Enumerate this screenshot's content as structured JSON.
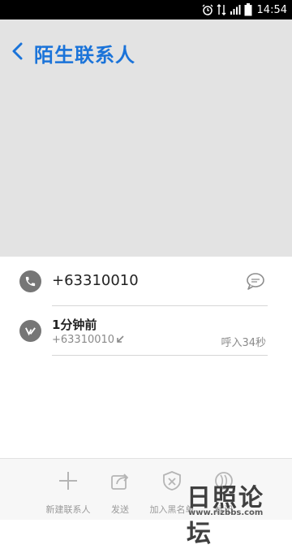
{
  "status": {
    "time": "14:54"
  },
  "header": {
    "title": "陌生联系人"
  },
  "contact": {
    "phone": "+63310010"
  },
  "call_log": {
    "time_ago": "1分钟前",
    "number": "+63310010",
    "duration": "呼入34秒"
  },
  "actions": [
    {
      "label": "新建联系人",
      "icon": "plus-icon"
    },
    {
      "label": "发送",
      "icon": "share-icon"
    },
    {
      "label": "加入黑名单",
      "icon": "block-shield-icon"
    },
    {
      "label": "标记",
      "icon": "mark-icon"
    }
  ],
  "watermark": {
    "text": "日照论坛",
    "url": "www.rizbbs.com"
  },
  "colors": {
    "accent": "#1a73d9",
    "header_bg": "#e3e3e3",
    "icon_gray": "#767676"
  }
}
